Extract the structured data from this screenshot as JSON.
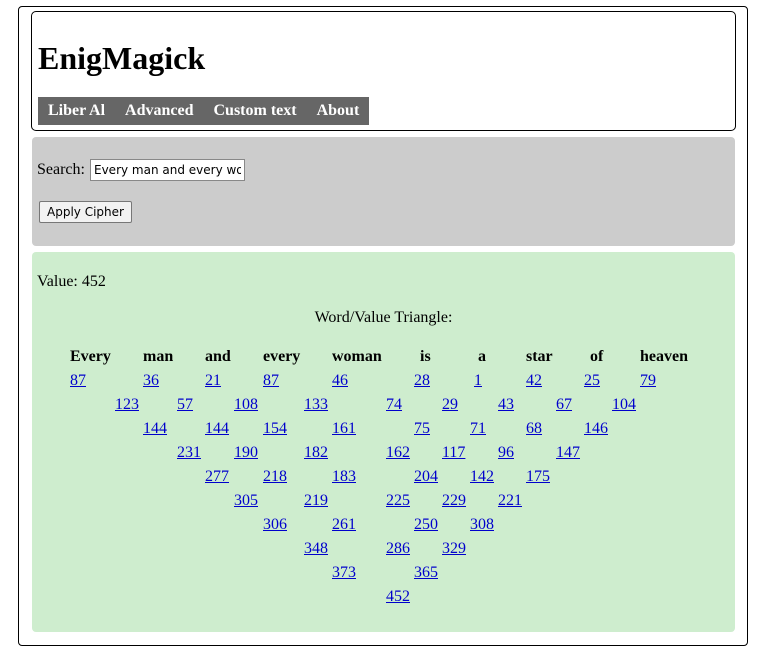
{
  "site": {
    "title": "EnigMagick"
  },
  "nav": {
    "items": [
      "Liber Al",
      "Advanced",
      "Custom text",
      "About"
    ]
  },
  "search": {
    "label": "Search:",
    "value": "Every man and every woman is a star of heaven",
    "button_label": "Apply Cipher"
  },
  "result": {
    "value_label": "Value: 452",
    "triangle_heading": "Word/Value Triangle:",
    "words": [
      "Every",
      "man",
      "and",
      "every",
      "woman",
      "is",
      "a",
      "star",
      "of",
      "heaven"
    ],
    "rows": [
      [
        "87",
        "36",
        "21",
        "87",
        "46",
        "28",
        "1",
        "42",
        "25",
        "79"
      ],
      [
        "123",
        "57",
        "108",
        "133",
        "74",
        "29",
        "43",
        "67",
        "104"
      ],
      [
        "144",
        "144",
        "154",
        "161",
        "75",
        "71",
        "68",
        "146"
      ],
      [
        "231",
        "190",
        "182",
        "162",
        "117",
        "96",
        "147"
      ],
      [
        "277",
        "218",
        "183",
        "204",
        "142",
        "175"
      ],
      [
        "305",
        "219",
        "225",
        "229",
        "221"
      ],
      [
        "306",
        "261",
        "250",
        "308"
      ],
      [
        "348",
        "286",
        "329"
      ],
      [
        "373",
        "365"
      ],
      [
        "452"
      ]
    ]
  }
}
